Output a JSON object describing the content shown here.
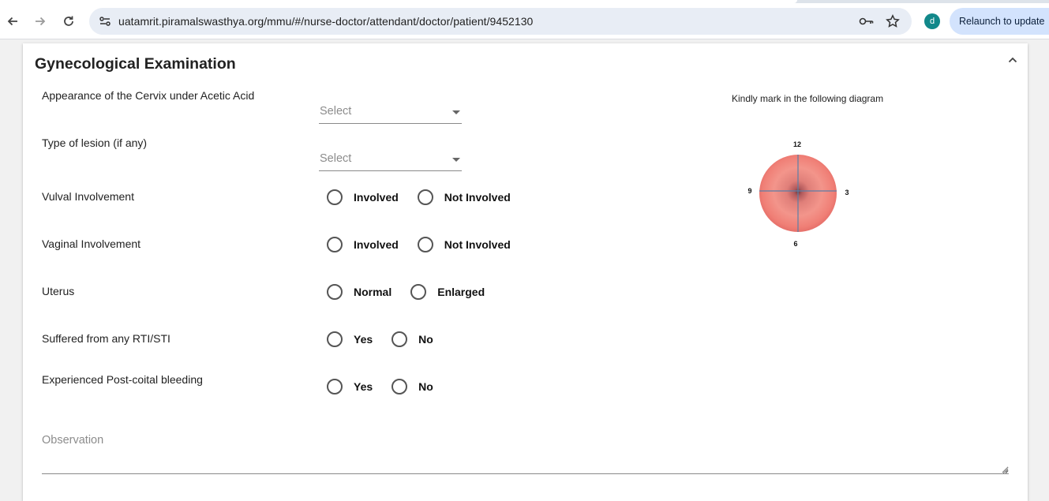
{
  "browser": {
    "url": "uatamrit.piramalswasthya.org/mmu/#/nurse-doctor/attendant/doctor/patient/9452130",
    "avatar_letter": "d",
    "relaunch_label": "Relaunch to update"
  },
  "section": {
    "title": "Gynecological Examination"
  },
  "fields": {
    "cervix": {
      "label": "Appearance of the Cervix under Acetic Acid",
      "placeholder": "Select"
    },
    "lesion": {
      "label": "Type of lesion (if any)",
      "placeholder": "Select"
    },
    "vulval": {
      "label": "Vulval Involvement",
      "options": [
        "Involved",
        "Not Involved"
      ]
    },
    "vaginal": {
      "label": "Vaginal Involvement",
      "options": [
        "Involved",
        "Not Involved"
      ]
    },
    "uterus": {
      "label": "Uterus",
      "options": [
        "Normal",
        "Enlarged"
      ]
    },
    "rti": {
      "label": "Suffered from any RTI/STI",
      "options": [
        "Yes",
        "No"
      ]
    },
    "bleeding": {
      "label": "Experienced Post-coital bleeding",
      "options": [
        "Yes",
        "No"
      ]
    }
  },
  "diagram": {
    "caption": "Kindly mark in the following diagram",
    "marks": {
      "top": "12",
      "right": "3",
      "bottom": "6",
      "left": "9"
    }
  },
  "observation": {
    "label": "Observation"
  },
  "colors": {
    "accent": "#12888a",
    "cervix": "#f08a82",
    "relaunch_bg": "#d3e3fd"
  }
}
